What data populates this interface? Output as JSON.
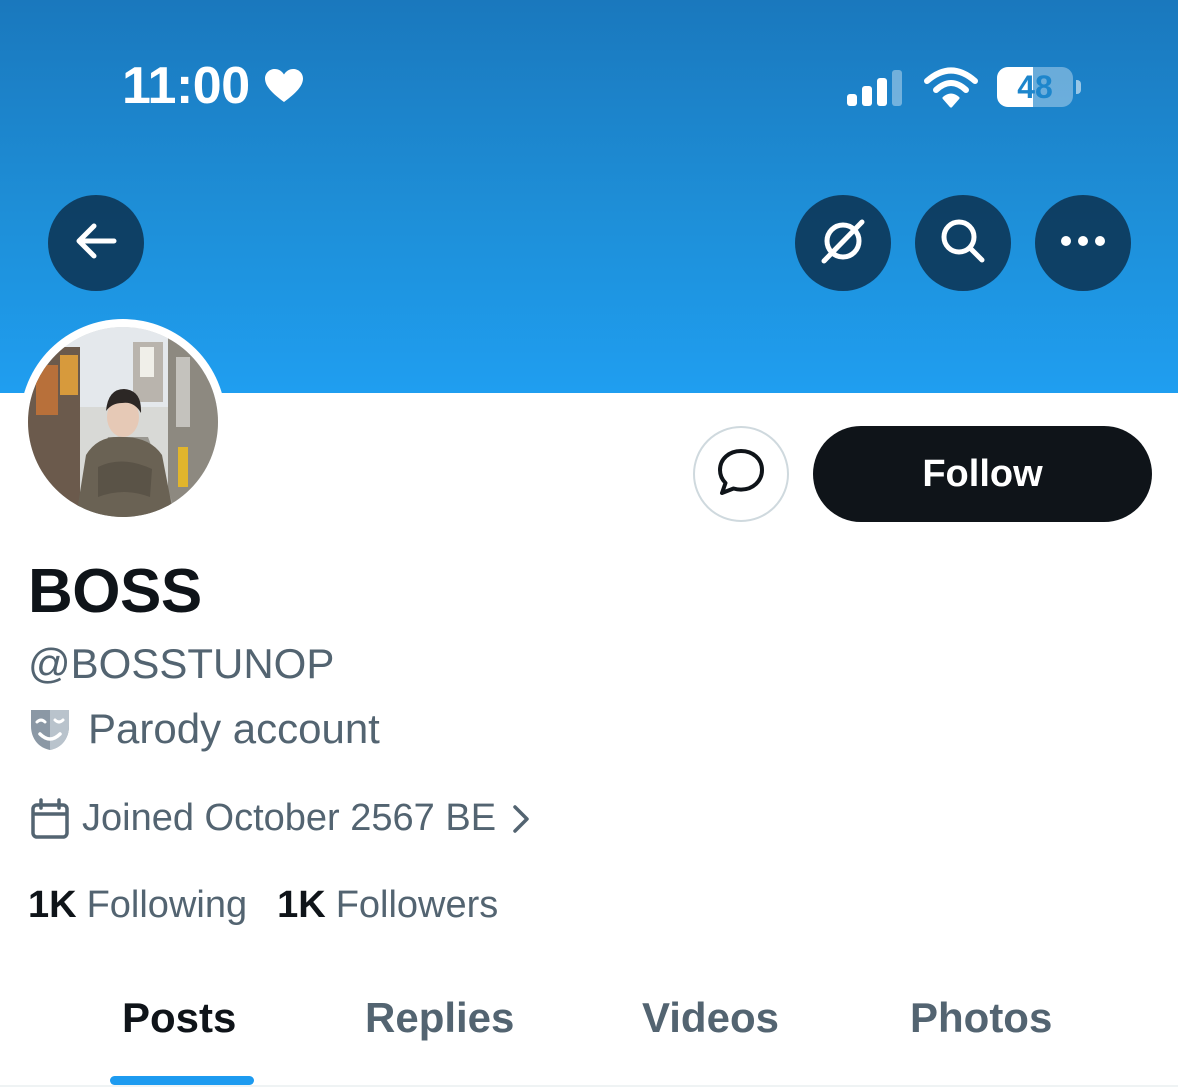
{
  "status_bar": {
    "time": "11:00",
    "battery_level": "48",
    "battery_fraction": 0.48,
    "signal_bars_filled": 3,
    "signal_bars_total": 4
  },
  "header": {
    "back_icon": "arrow-left-icon",
    "action_icons": [
      "grok-icon",
      "search-icon",
      "more-icon"
    ],
    "banner_color": "#1d9bf0"
  },
  "profile": {
    "display_name": "BOSS",
    "handle": "@BOSSTUNOP",
    "label_icon": "parody-mask-icon",
    "label": "Parody account",
    "joined": "Joined October 2567 BE",
    "follow_label": "Follow",
    "message_icon": "message-bubble-icon"
  },
  "stats": {
    "following_count": "1K",
    "following_label": "Following",
    "followers_count": "1K",
    "followers_label": "Followers"
  },
  "tabs": [
    {
      "label": "Posts",
      "active": true
    },
    {
      "label": "Replies",
      "active": false
    },
    {
      "label": "Videos",
      "active": false
    },
    {
      "label": "Photos",
      "active": false
    }
  ],
  "colors": {
    "accent": "#1d9bf0",
    "text_primary": "#0f1419",
    "text_secondary": "#536471"
  }
}
